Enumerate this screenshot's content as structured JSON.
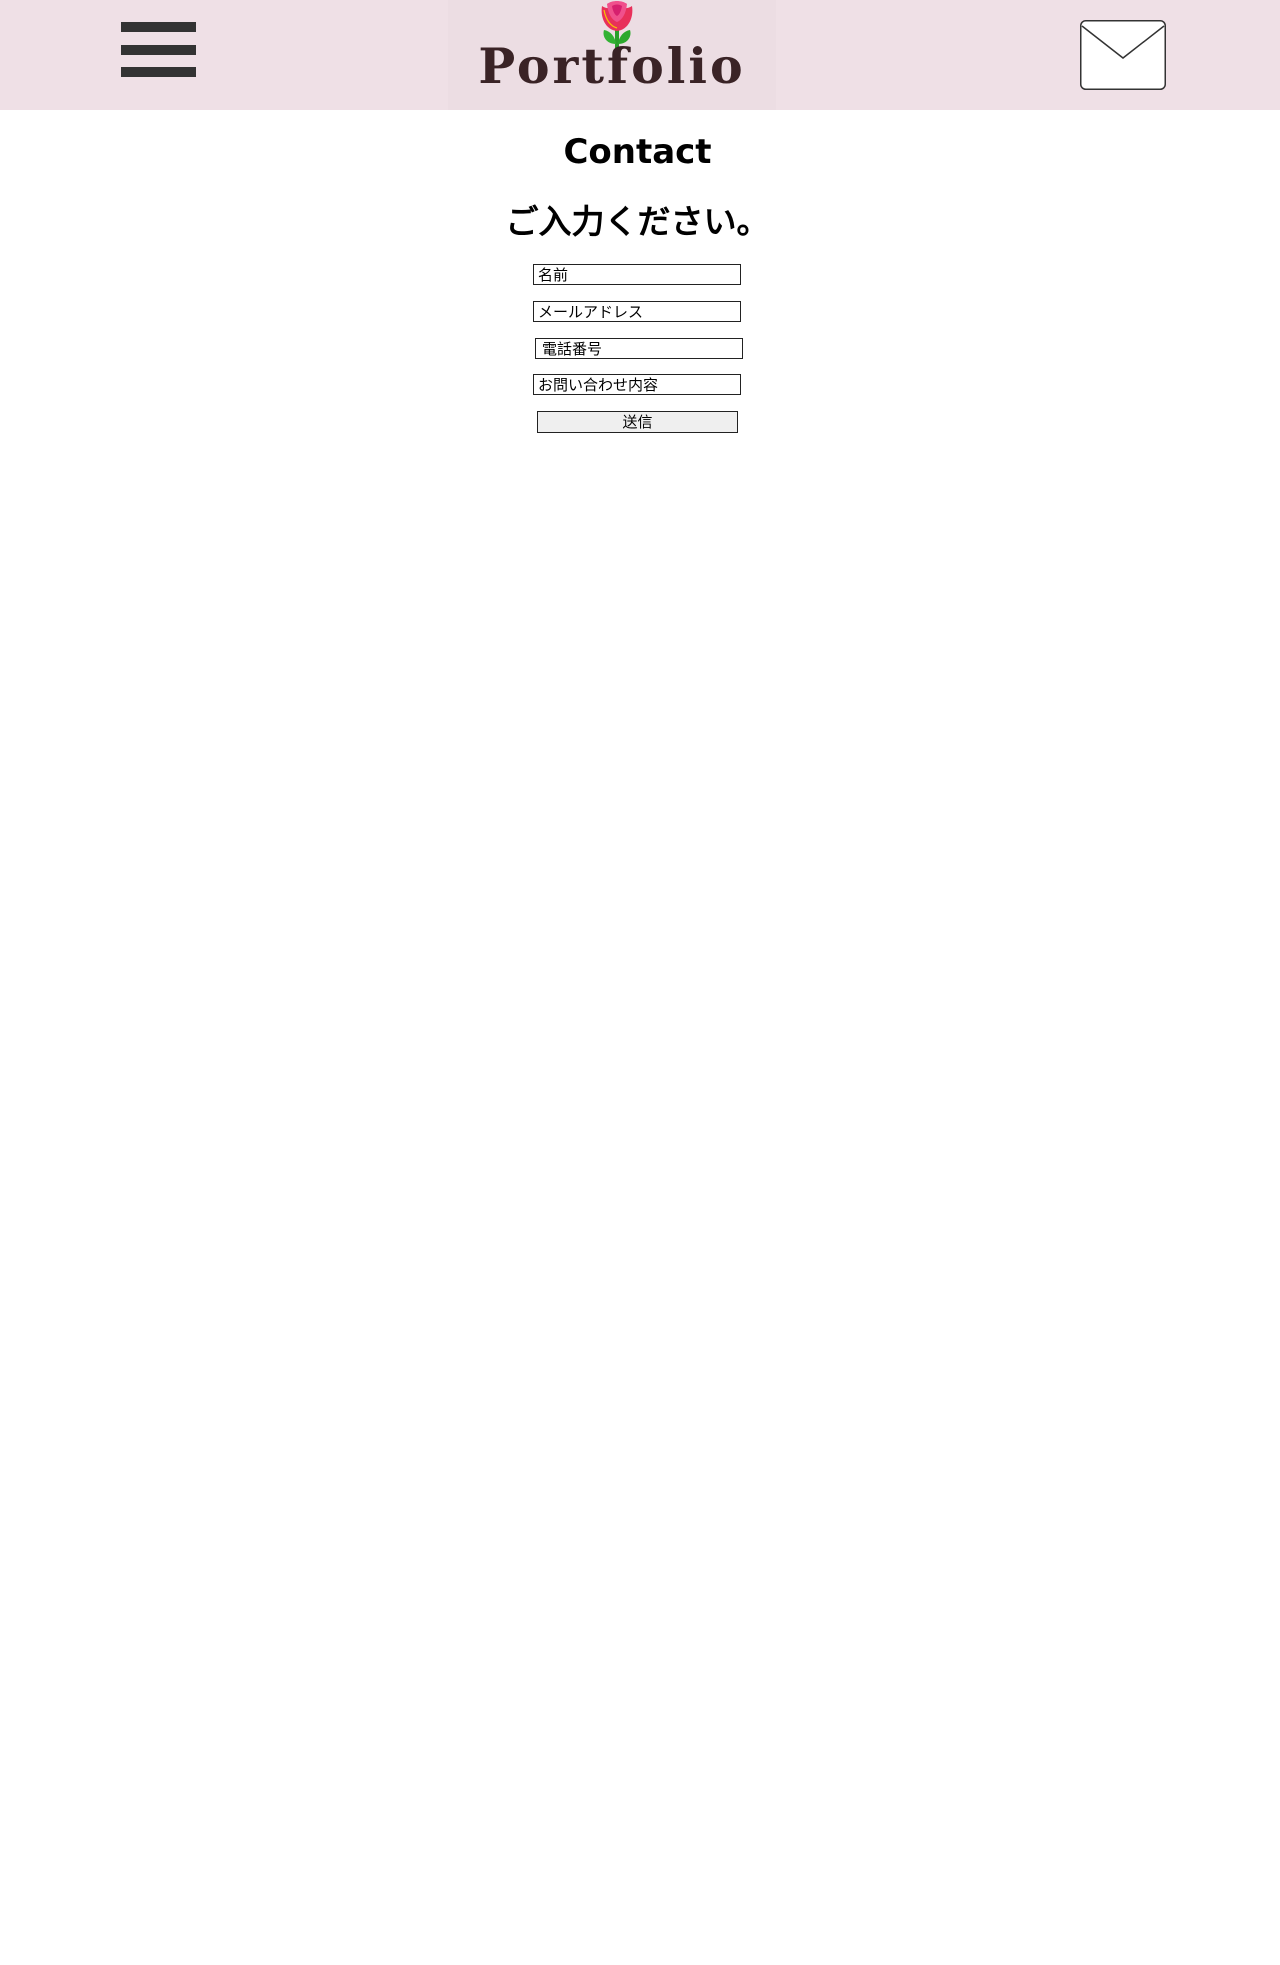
{
  "header": {
    "logo_text": "Portfolio",
    "menu_icon": "hamburger-menu-icon",
    "mail_icon": "envelope-icon",
    "logo_icon": "rose-icon",
    "background_color": "#efe0e6"
  },
  "main": {
    "title": "Contact",
    "subtitle": "ご入力ください。",
    "form": {
      "name_placeholder": "名前",
      "email_placeholder": "メールアドレス",
      "phone_placeholder": "電話番号",
      "message_placeholder": "お問い合わせ内容",
      "submit_label": "送信"
    }
  }
}
